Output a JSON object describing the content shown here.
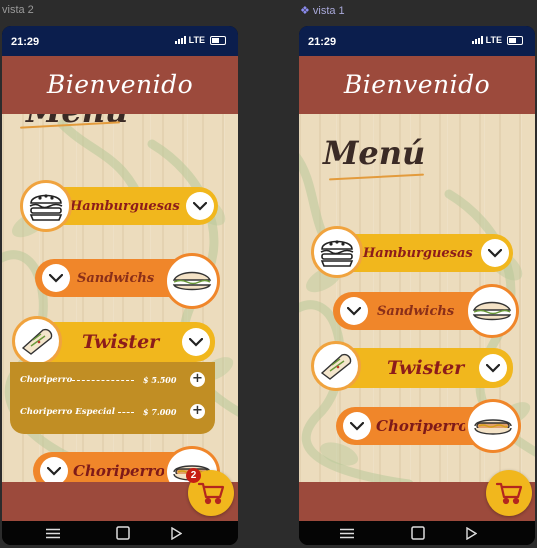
{
  "frames": [
    {
      "label": "vista 2",
      "component_icon": false
    },
    {
      "label": "vista 1",
      "component_icon": true
    }
  ],
  "status": {
    "time": "21:29",
    "network": "LTE"
  },
  "app": {
    "header_title": "Bienvenido",
    "menu_title": "Menú",
    "categories": [
      {
        "label": "Hamburguesas",
        "food_icon": "burger-icon",
        "color": "#f1b71d"
      },
      {
        "label": "Sandwichs",
        "food_icon": "sandwich-icon",
        "color": "#f0862a"
      },
      {
        "label": "Twister",
        "food_icon": "wrap-icon",
        "color": "#f1b71d"
      },
      {
        "label": "Choriperro",
        "food_icon": "hotdog-icon",
        "color": "#f0862a"
      }
    ],
    "twister_items": [
      {
        "name": "Choriperro",
        "price": "$ 5.500"
      },
      {
        "name": "Choriperro Especial",
        "price": "$ 7.000"
      }
    ],
    "cart_badge": "2"
  },
  "colors": {
    "header": "#9c4a3c",
    "yellow": "#f1b71d",
    "orange": "#f0862a",
    "label_red": "#8c1c1b",
    "dropdown": "#c18e24",
    "status_bar": "#0b1e4d"
  }
}
